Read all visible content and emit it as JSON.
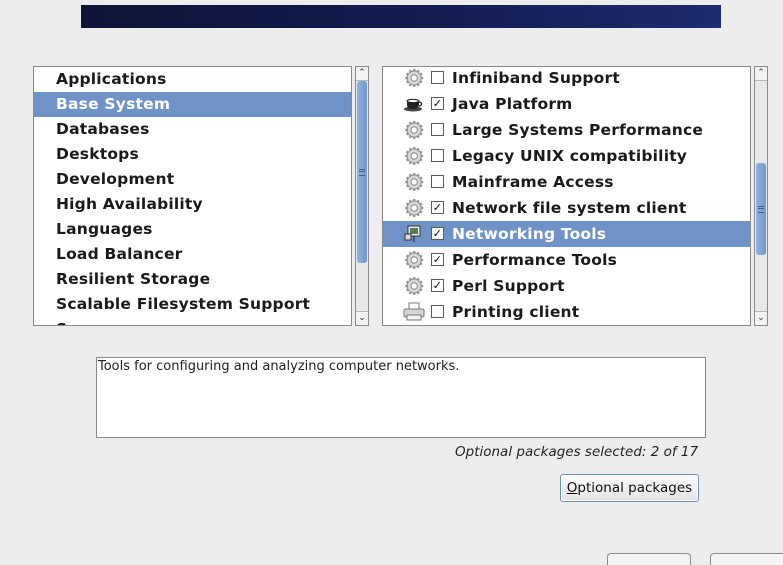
{
  "categories": [
    {
      "label": "Applications",
      "selected": false
    },
    {
      "label": "Base System",
      "selected": true
    },
    {
      "label": "Databases",
      "selected": false
    },
    {
      "label": "Desktops",
      "selected": false
    },
    {
      "label": "Development",
      "selected": false
    },
    {
      "label": "High Availability",
      "selected": false
    },
    {
      "label": "Languages",
      "selected": false
    },
    {
      "label": "Load Balancer",
      "selected": false
    },
    {
      "label": "Resilient Storage",
      "selected": false
    },
    {
      "label": "Scalable Filesystem Support",
      "selected": false
    },
    {
      "label": "S...",
      "selected": false
    }
  ],
  "packages": [
    {
      "label": "Infiniband Support",
      "checked": false,
      "icon": "gear-icon",
      "selected": false
    },
    {
      "label": "Java Platform",
      "checked": true,
      "icon": "coffee-cup-icon",
      "selected": false
    },
    {
      "label": "Large Systems Performance",
      "checked": false,
      "icon": "gear-icon",
      "selected": false
    },
    {
      "label": "Legacy UNIX compatibility",
      "checked": false,
      "icon": "gear-icon",
      "selected": false
    },
    {
      "label": "Mainframe Access",
      "checked": false,
      "icon": "gear-icon",
      "selected": false
    },
    {
      "label": "Network file system client",
      "checked": true,
      "icon": "gear-icon",
      "selected": false
    },
    {
      "label": "Networking Tools",
      "checked": true,
      "icon": "network-icon",
      "selected": true
    },
    {
      "label": "Performance Tools",
      "checked": true,
      "icon": "gear-icon",
      "selected": false
    },
    {
      "label": "Perl Support",
      "checked": true,
      "icon": "gear-icon",
      "selected": false
    },
    {
      "label": "Printing client",
      "checked": false,
      "icon": "printer-icon",
      "selected": false
    }
  ],
  "description": "Tools for configuring and analyzing computer networks.",
  "status": "Optional packages selected: 2 of 17",
  "optional_button": {
    "first_letter": "O",
    "rest": "ptional packages"
  },
  "colors": {
    "selection": "#6f93c6",
    "banner": "#131d52"
  }
}
